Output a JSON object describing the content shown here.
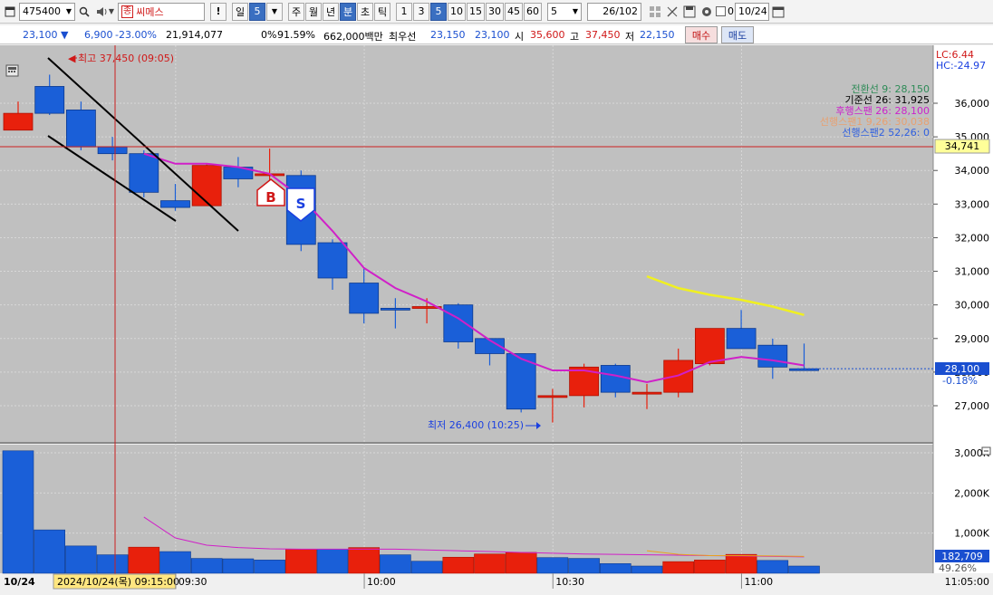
{
  "toolbar": {
    "code": "475400",
    "badge": "종",
    "name": "씨메스",
    "exclaim": "!",
    "period_day": "일",
    "period_num": "5",
    "periods": [
      "주",
      "월",
      "년",
      "분",
      "초",
      "틱"
    ],
    "minutes": [
      "1",
      "3",
      "5",
      "10",
      "15",
      "30",
      "45",
      "60"
    ],
    "count": "5",
    "page": "26/102",
    "check_label": "0",
    "date": "10/24"
  },
  "quote": {
    "price": "23,100 ▼",
    "change": "6,900",
    "rate": "-23.00%",
    "volume": "21,914,077",
    "pct1": "0%",
    "pct2": "91.59%",
    "amount": "662,000백만",
    "best_label": "최우선",
    "best_ask": "23,150",
    "best_bid": "23,100",
    "open_label": "시",
    "open": "35,600",
    "high_label": "고",
    "high": "37,450",
    "low_label": "저",
    "low": "22,150",
    "buy_label": "매수",
    "sell_label": "매도"
  },
  "chart": {
    "top_right": [
      "LC:6.44",
      "HC:-24.97"
    ],
    "legend": [
      {
        "text": "전환선 9: 28,150",
        "color": "#2e8b57"
      },
      {
        "text": "기준선 26: 31,925",
        "color": "#000000"
      },
      {
        "text": "후행스팬 26: 28,100",
        "color": "#cc22cc"
      },
      {
        "text": "선행스팬1 9,26: 30,038",
        "color": "#e8a070"
      },
      {
        "text": "선행스팬2 52,26: 0",
        "color": "#3060e0"
      }
    ],
    "price_ticks": [
      "36,000",
      "35,000",
      "34,000",
      "33,000",
      "32,000",
      "31,000",
      "30,000",
      "29,000",
      "28,000",
      "27,000"
    ],
    "ref_line_label": "34,741",
    "current_label": "28,100",
    "current_pct": "-0.18%",
    "high_annotation": "최고 37,450 (09:05)",
    "low_annotation": "최저 26,400 (10:25)",
    "buy_marker": "B",
    "sell_marker": "S",
    "vol_ticks": [
      "3,000K",
      "2,000K",
      "1,000K"
    ],
    "vol_label": "182,709",
    "vol_pct": "49.26%",
    "date_label": "10/24",
    "cursor_label": "2024/10/24(목) 09:15:00",
    "time_labels": [
      "09:30",
      "10:00",
      "10:30",
      "11:00",
      "11:05:00"
    ],
    "candles": [
      {
        "o": 35700,
        "h": 36050,
        "l": 35200,
        "c": 35200,
        "up": true
      },
      {
        "o": 36500,
        "h": 36850,
        "l": 35650,
        "c": 35700,
        "up": false
      },
      {
        "o": 35800,
        "h": 36050,
        "l": 34600,
        "c": 34700,
        "up": false
      },
      {
        "o": 34700,
        "h": 35000,
        "l": 34300,
        "c": 34500,
        "up": false
      },
      {
        "o": 34500,
        "h": 34600,
        "l": 33200,
        "c": 33350,
        "up": false
      },
      {
        "o": 33100,
        "h": 33600,
        "l": 32800,
        "c": 32900,
        "up": false
      },
      {
        "o": 32950,
        "h": 34200,
        "l": 32950,
        "c": 34150,
        "up": true
      },
      {
        "o": 34100,
        "h": 34400,
        "l": 33500,
        "c": 33750,
        "up": false
      },
      {
        "o": 33900,
        "h": 34650,
        "l": 33600,
        "c": 33900,
        "up": true
      },
      {
        "o": 33850,
        "h": 34000,
        "l": 31600,
        "c": 31800,
        "up": false
      },
      {
        "o": 31850,
        "h": 31950,
        "l": 30450,
        "c": 30800,
        "up": false
      },
      {
        "o": 30650,
        "h": 31100,
        "l": 29450,
        "c": 29750,
        "up": false
      },
      {
        "o": 29900,
        "h": 30200,
        "l": 29300,
        "c": 29900,
        "up": false
      },
      {
        "o": 29950,
        "h": 30200,
        "l": 29450,
        "c": 29900,
        "up": true
      },
      {
        "o": 30000,
        "h": 30050,
        "l": 28700,
        "c": 28900,
        "up": false
      },
      {
        "o": 29000,
        "h": 29000,
        "l": 28200,
        "c": 28550,
        "up": false
      },
      {
        "o": 28550,
        "h": 28550,
        "l": 26800,
        "c": 26900,
        "up": false
      },
      {
        "o": 27300,
        "h": 27500,
        "l": 26500,
        "c": 27300,
        "up": true
      },
      {
        "o": 27300,
        "h": 28250,
        "l": 26950,
        "c": 28150,
        "up": true
      },
      {
        "o": 28200,
        "h": 28250,
        "l": 27250,
        "c": 27400,
        "up": false
      },
      {
        "o": 27350,
        "h": 27650,
        "l": 26900,
        "c": 27400,
        "up": true
      },
      {
        "o": 27400,
        "h": 28700,
        "l": 27250,
        "c": 28350,
        "up": true
      },
      {
        "o": 28250,
        "h": 29300,
        "l": 28200,
        "c": 29300,
        "up": true
      },
      {
        "o": 29300,
        "h": 29850,
        "l": 28700,
        "c": 28700,
        "up": false
      },
      {
        "o": 28800,
        "h": 29000,
        "l": 27800,
        "c": 28150,
        "up": false
      },
      {
        "o": 28100,
        "h": 28850,
        "l": 28100,
        "c": 28100,
        "up": false
      }
    ],
    "volumes": [
      {
        "v": 3050,
        "up": false
      },
      {
        "v": 1080,
        "up": false
      },
      {
        "v": 680,
        "up": false
      },
      {
        "v": 460,
        "up": false
      },
      {
        "v": 650,
        "up": true
      },
      {
        "v": 540,
        "up": false
      },
      {
        "v": 370,
        "up": false
      },
      {
        "v": 360,
        "up": false
      },
      {
        "v": 330,
        "up": false
      },
      {
        "v": 600,
        "up": true
      },
      {
        "v": 600,
        "up": false
      },
      {
        "v": 640,
        "up": true
      },
      {
        "v": 460,
        "up": false
      },
      {
        "v": 300,
        "up": false
      },
      {
        "v": 400,
        "up": true
      },
      {
        "v": 480,
        "up": true
      },
      {
        "v": 520,
        "up": true
      },
      {
        "v": 390,
        "up": false
      },
      {
        "v": 370,
        "up": false
      },
      {
        "v": 240,
        "up": false
      },
      {
        "v": 180,
        "up": false
      },
      {
        "v": 290,
        "up": true
      },
      {
        "v": 330,
        "up": true
      },
      {
        "v": 470,
        "up": true
      },
      {
        "v": 320,
        "up": false
      },
      {
        "v": 180,
        "up": false
      }
    ],
    "magenta_line": [
      null,
      null,
      null,
      null,
      34500,
      34200,
      34200,
      34100,
      33900,
      33200,
      32200,
      31100,
      30500,
      30100,
      29600,
      28950,
      28400,
      28050,
      28050,
      27900,
      27700,
      27900,
      28300,
      28450,
      28350,
      28200
    ],
    "yellow_line": [
      30850,
      30500,
      30300,
      30150,
      29950,
      29700
    ],
    "vol_ma": [
      null,
      null,
      null,
      null,
      1400,
      880,
      700,
      640,
      610,
      600,
      600,
      600,
      600,
      580,
      560,
      540,
      520,
      500,
      480,
      470,
      460,
      450,
      440,
      430,
      420,
      410
    ],
    "vol_ma2": [
      null,
      null,
      null,
      null,
      null,
      null,
      null,
      null,
      null,
      null,
      null,
      null,
      null,
      null,
      null,
      null,
      null,
      null,
      null,
      null,
      560,
      470,
      440,
      440,
      430,
      420
    ]
  }
}
